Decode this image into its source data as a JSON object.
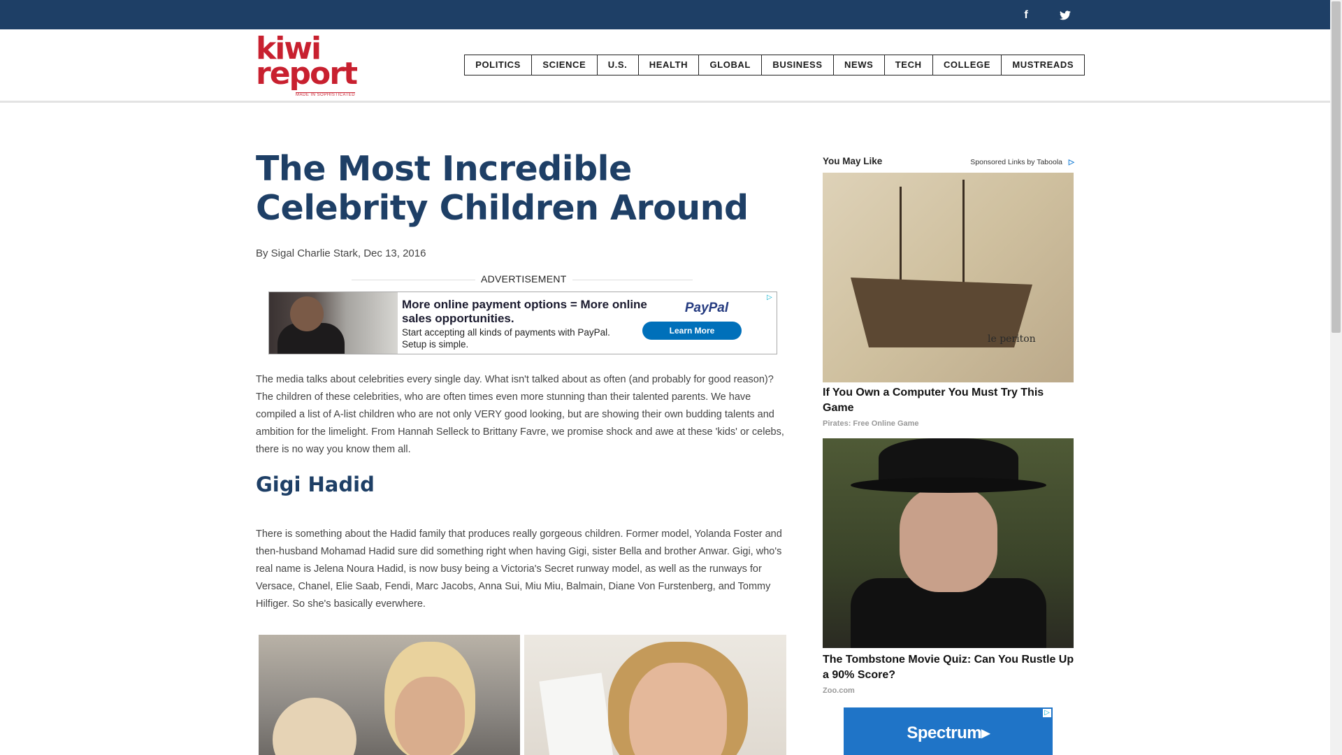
{
  "social": {
    "facebook_icon": "f",
    "twitter_icon": "t"
  },
  "logo": {
    "line1": "kiwi",
    "line2": "report",
    "tagline": "MADE IN SOPHISTICATED"
  },
  "nav": {
    "items": [
      "POLITICS",
      "SCIENCE",
      "U.S.",
      "HEALTH",
      "GLOBAL",
      "BUSINESS",
      "NEWS",
      "TECH",
      "COLLEGE",
      "MUSTREADS"
    ]
  },
  "article": {
    "title": "The Most Incredible Celebrity Children Around",
    "byline": "By Sigal Charlie Stark, Dec 13, 2016",
    "ad_label": "ADVERTISEMENT",
    "intro": "The media talks about celebrities every single day. What isn't talked about as often (and probably for good reason)? The children of these celebrities, who are often times even more stunning than their talented parents. We have compiled a list of A-list children who are not only VERY good looking, but are showing their own budding talents and ambition for the limelight. From Hannah Selleck to Brittany Favre, we promise shock and awe at these 'kids' or celebs, there is no way you know them all.",
    "section_heading": "Gigi Hadid",
    "section_text": "There is something about the Hadid family that produces really gorgeous children. Former model, Yolanda Foster and then-husband Mohamad Hadid sure did something right when having Gigi, sister Bella and brother Anwar. Gigi, who's real name is Jelena Noura Hadid, is now busy being a Victoria's Secret runway model, as well as the runways for Versace, Chanel, Elie Saab, Fendi, Marc Jacobs, Anna Sui, Miu Miu, Balmain, Diane Von Furstenberg, and Tommy Hilfiger. So she's basically everwhere."
  },
  "ad_banner": {
    "headline": "More online payment options = More online sales opportunities.",
    "subtext": "Start accepting all kinds of payments with PayPal. Setup is simple.",
    "brand": "PayPal",
    "button": "Learn More",
    "adchoices_icon": "▷"
  },
  "sidebar": {
    "heading": "You May Like",
    "sponsored": "Sponsored Links by Taboola",
    "taboola_icon": "▷",
    "cards": [
      {
        "title": "If You Own a Computer You Must Try This Game",
        "source": "Pirates: Free Online Game",
        "image_label": "le periton"
      },
      {
        "title": "The Tombstone Movie Quiz: Can You Rustle Up a 90% Score?",
        "source": "Zoo.com"
      }
    ],
    "spectrum_ad": "Spectrum▸",
    "spectrum_choice_icon": "▷"
  }
}
